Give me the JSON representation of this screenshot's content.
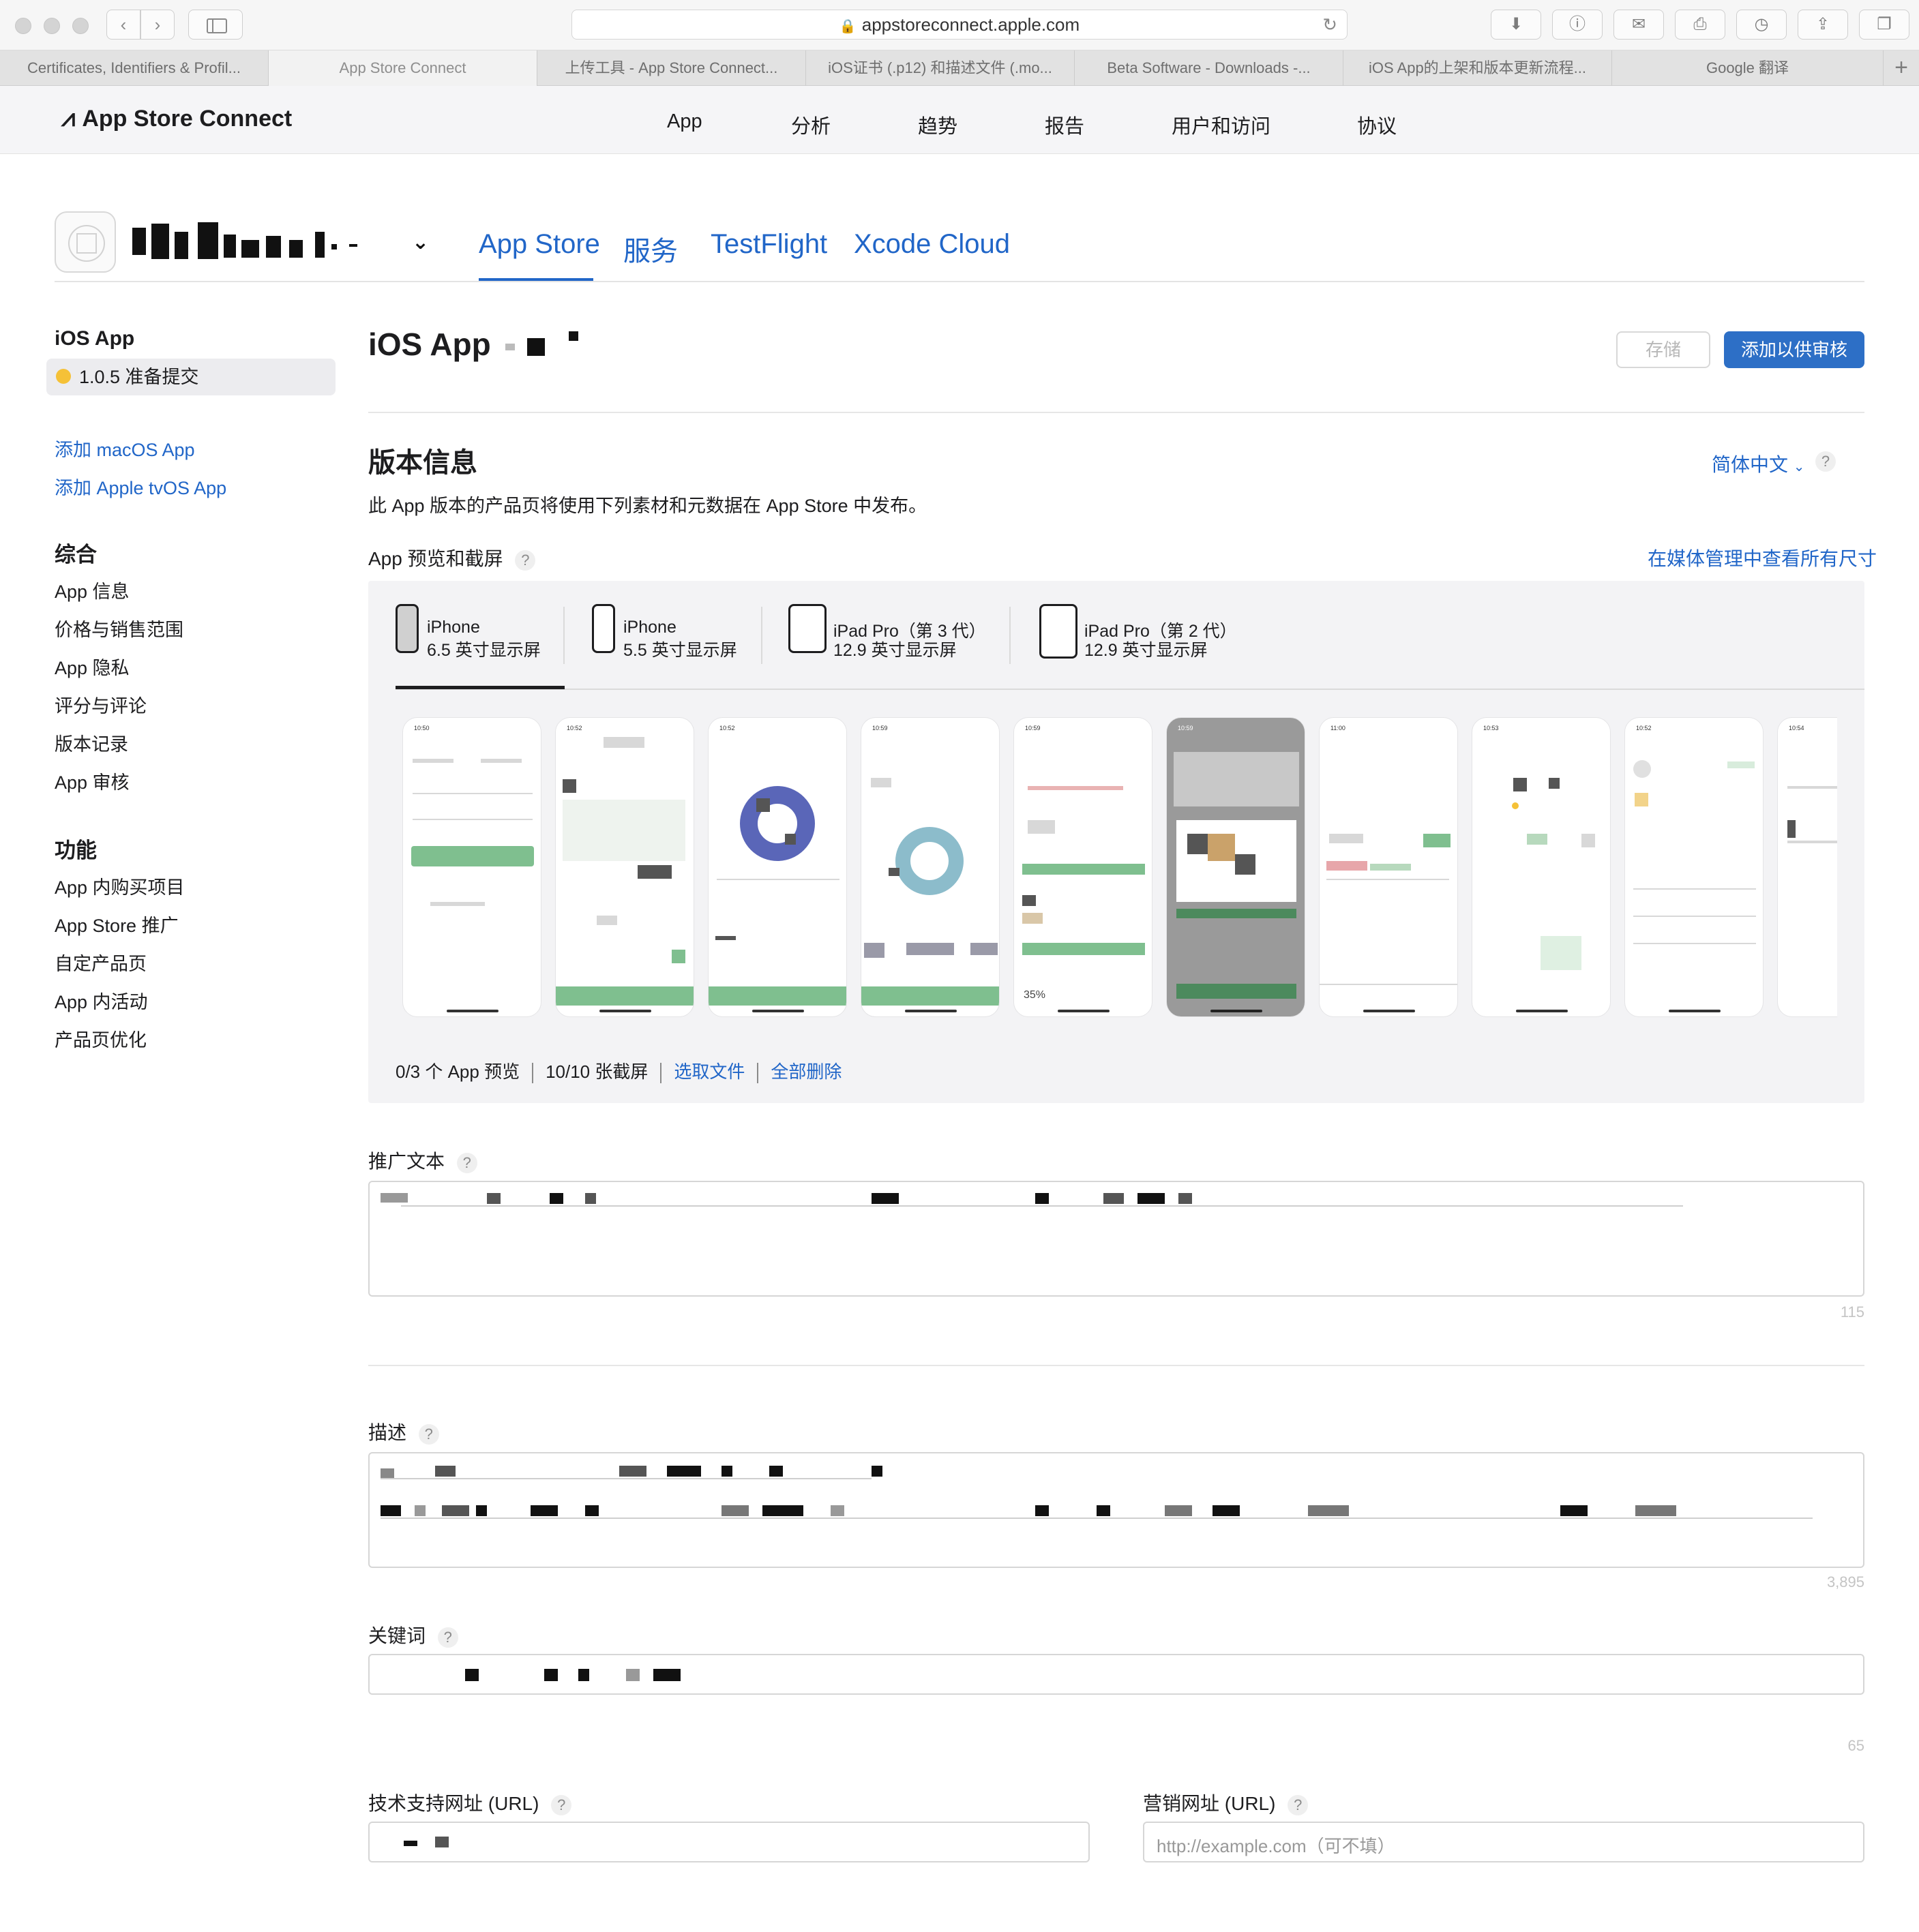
{
  "browser": {
    "url": "appstoreconnect.apple.com",
    "tabs": [
      "Certificates, Identifiers & Profil...",
      "App Store Connect",
      "上传工具 - App Store Connect...",
      "iOS证书 (.p12) 和描述文件 (.mo...",
      "Beta Software - Downloads -...",
      "iOS App的上架和版本更新流程...",
      "Google 翻译"
    ],
    "active_tab": 1
  },
  "header": {
    "logo": "App Store Connect",
    "nav": [
      "App",
      "分析",
      "趋势",
      "报告",
      "用户和访问",
      "协议"
    ]
  },
  "app": {
    "platform_tabs": [
      "App Store",
      "服务",
      "TestFlight",
      "Xcode Cloud"
    ],
    "active_platform": "App Store"
  },
  "sidebar": {
    "title": "iOS App",
    "version": "1.0.5 准备提交",
    "add_links": [
      "添加 macOS App",
      "添加 Apple tvOS App"
    ],
    "sections": [
      {
        "title": "综合",
        "items": [
          "App 信息",
          "价格与销售范围",
          "App 隐私",
          "评分与评论",
          "版本记录",
          "App 审核"
        ]
      },
      {
        "title": "功能",
        "items": [
          "App 内购买项目",
          "App Store 推广",
          "自定产品页",
          "App 内活动",
          "产品页优化"
        ]
      }
    ]
  },
  "main": {
    "title": "iOS App",
    "save_label": "存储",
    "submit_label": "添加以供审核",
    "section_title": "版本信息",
    "language": "简体中文",
    "section_desc": "此 App 版本的产品页将使用下列素材和元数据在 App Store 中发布。",
    "previews_label": "App 预览和截屏",
    "media_link": "在媒体管理中查看所有尺寸",
    "devices": [
      {
        "name": "iPhone",
        "size": "6.5 英寸显示屏"
      },
      {
        "name": "iPhone",
        "size": "5.5 英寸显示屏"
      },
      {
        "name": "iPad Pro（第 3 代）",
        "size": "12.9 英寸显示屏"
      },
      {
        "name": "iPad Pro（第 2 代）",
        "size": "12.9 英寸显示屏"
      }
    ],
    "screenshot_times": [
      "10:50",
      "10:52",
      "10:52",
      "10:59",
      "10:59",
      "10:59",
      "11:00",
      "10:53",
      "10:52",
      "10:54"
    ],
    "screenshot_percent": "35%",
    "preview_count": "0/3 个 App 预览",
    "screenshot_count": "10/10 张截屏",
    "choose_file": "选取文件",
    "delete_all": "全部删除",
    "promo_label": "推广文本",
    "promo_count": "115",
    "desc_label": "描述",
    "desc_count": "3,895",
    "keywords_label": "关键词",
    "keywords_count": "65",
    "support_label": "技术支持网址 (URL)",
    "marketing_label": "营销网址 (URL)",
    "marketing_placeholder": "http://example.com（可不填）"
  },
  "colors": {
    "accent": "#2166c8",
    "submit_button": "#2d6fc6",
    "status_dot": "#f5c137",
    "screenshot_green": "#7fbf8f"
  }
}
